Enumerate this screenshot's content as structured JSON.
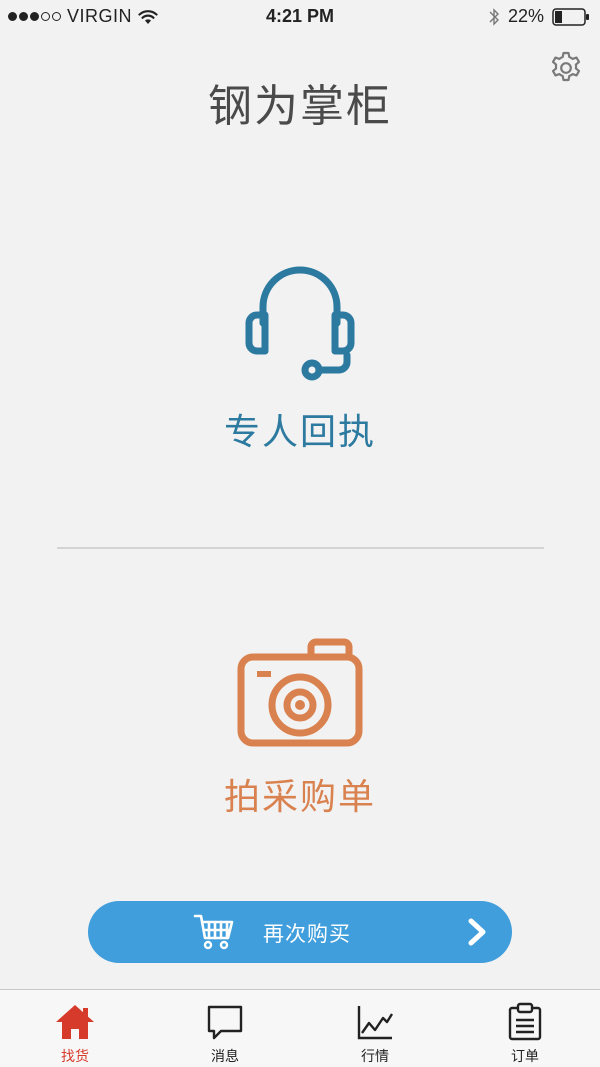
{
  "status_bar": {
    "carrier": "VIRGIN",
    "time": "4:21 PM",
    "battery": "22%"
  },
  "header": {
    "title": "钢为掌柜"
  },
  "features": {
    "service": {
      "label": "专人回执"
    },
    "photo": {
      "label": "拍采购单"
    }
  },
  "buy_again": {
    "label": "再次购买"
  },
  "tabs": [
    {
      "label": "找货",
      "icon": "home-icon"
    },
    {
      "label": "消息",
      "icon": "message-icon"
    },
    {
      "label": "行情",
      "icon": "chart-icon"
    },
    {
      "label": "订单",
      "icon": "clipboard-icon"
    }
  ],
  "colors": {
    "service_accent": "#2d7aa0",
    "photo_accent": "#d9824f",
    "button_blue": "#3f9edb",
    "tab_active": "#d63a2a",
    "background": "#f2f2f2"
  }
}
